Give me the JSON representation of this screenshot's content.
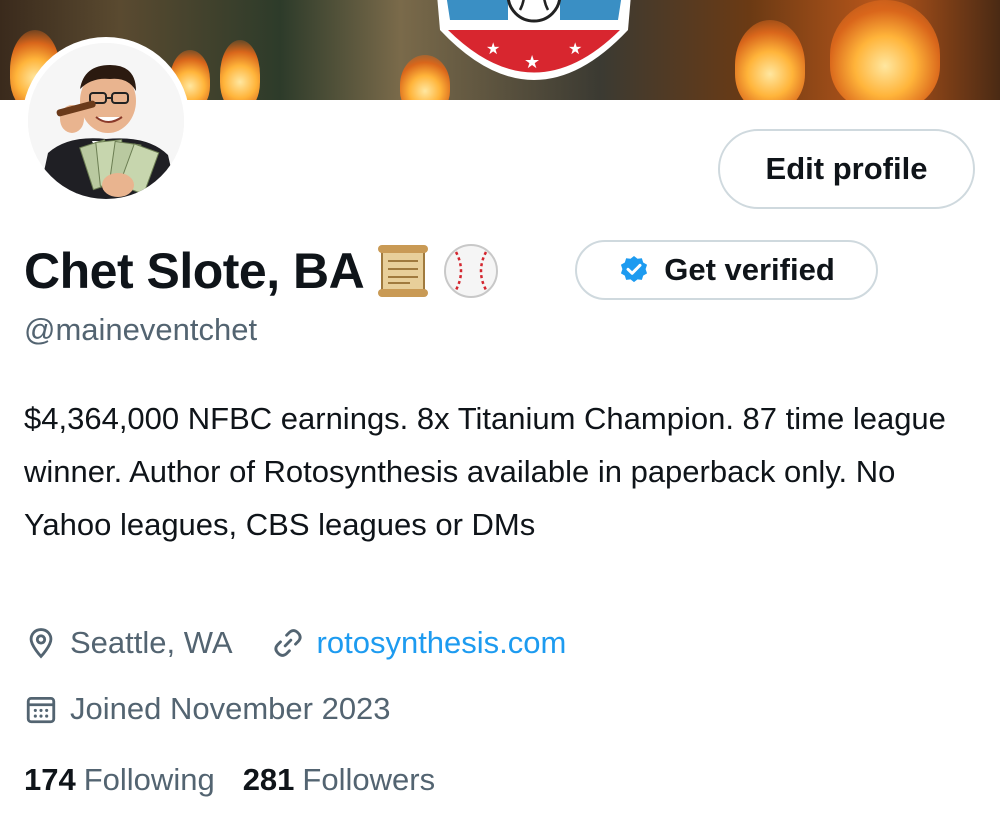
{
  "profile": {
    "name": "Chet Slote, BA",
    "name_emojis": [
      "scroll-icon",
      "baseball-icon"
    ],
    "handle": "@maineventchet",
    "bio": "$4,364,000 NFBC earnings. 8x Titanium Champion. 87 time league winner. Author of Rotosynthesis available in paperback only. No Yahoo leagues, CBS leagues or DMs",
    "location": "Seattle, WA",
    "website": "rotosynthesis.com",
    "joined": "Joined November 2023",
    "following_count": "174",
    "following_label": "Following",
    "followers_count": "281",
    "followers_label": "Followers"
  },
  "buttons": {
    "edit_profile": "Edit profile",
    "get_verified": "Get verified"
  },
  "colors": {
    "text_primary": "#0f1419",
    "text_secondary": "#536471",
    "link": "#1d9bf0",
    "verified_badge": "#1d9bf0",
    "button_border": "#cfd9de"
  }
}
